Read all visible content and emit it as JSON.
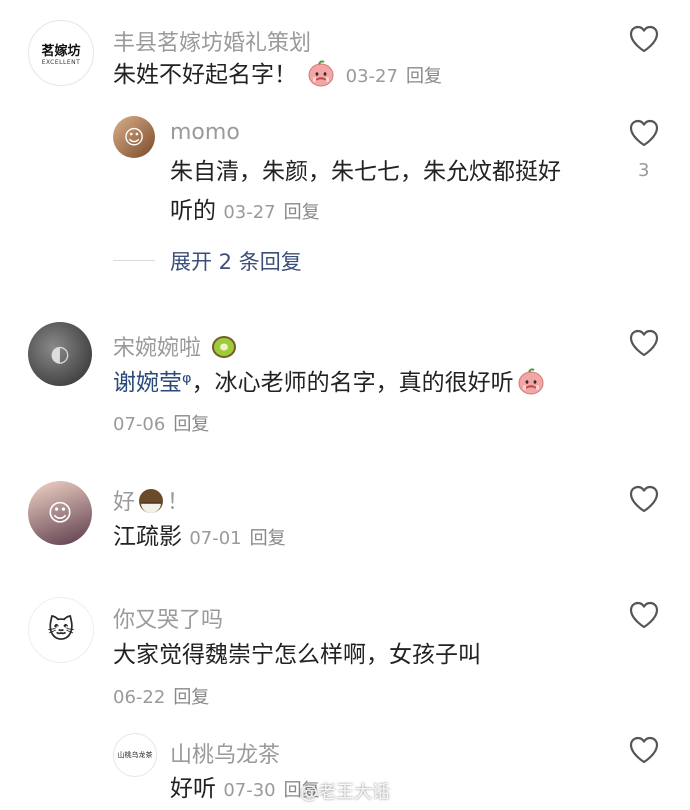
{
  "comments": [
    {
      "username": "丰县茗嫁坊婚礼策划",
      "avatar_text": "茗嫁坊",
      "avatar_sub": "EXCELLENT",
      "text": "朱姓不好起名字！",
      "date": "03-27",
      "reply_label": "回复",
      "emoji": "peach-emoji"
    },
    {
      "username": "momo",
      "text_line1": "朱自清，朱颜，朱七七，朱允炆都挺好",
      "text_line2": "听的",
      "date": "03-27",
      "reply_label": "回复",
      "like_count": "3"
    },
    {
      "username": "宋婉婉啦",
      "username_emoji": "kiwi-emoji",
      "mention": "谢婉莹ᵠ",
      "text": "，冰心老师的名字，真的很好听",
      "emoji": "peach-emoji",
      "date": "07-06",
      "reply_label": "回复"
    },
    {
      "username_prefix": "好",
      "username_emoji": "coconut-emoji",
      "username_suffix": "！",
      "text": "江疏影",
      "date": "07-01",
      "reply_label": "回复"
    },
    {
      "username": "你又哭了吗",
      "text": "大家觉得魏崇宁怎么样啊，女孩子叫",
      "date": "06-22",
      "reply_label": "回复"
    },
    {
      "username": "山桃乌龙茶",
      "avatar_text": "山桃乌龙茶",
      "text": "好听",
      "date": "07-30",
      "reply_label": "回复"
    }
  ],
  "expand_replies": "展开 2 条回复",
  "watermark": "@老王大话",
  "colors": {
    "username": "#9a9a9a",
    "text": "#222222",
    "mention": "#2b4a7a",
    "expand": "#3b4f7a",
    "heart_outline": "#555555"
  }
}
